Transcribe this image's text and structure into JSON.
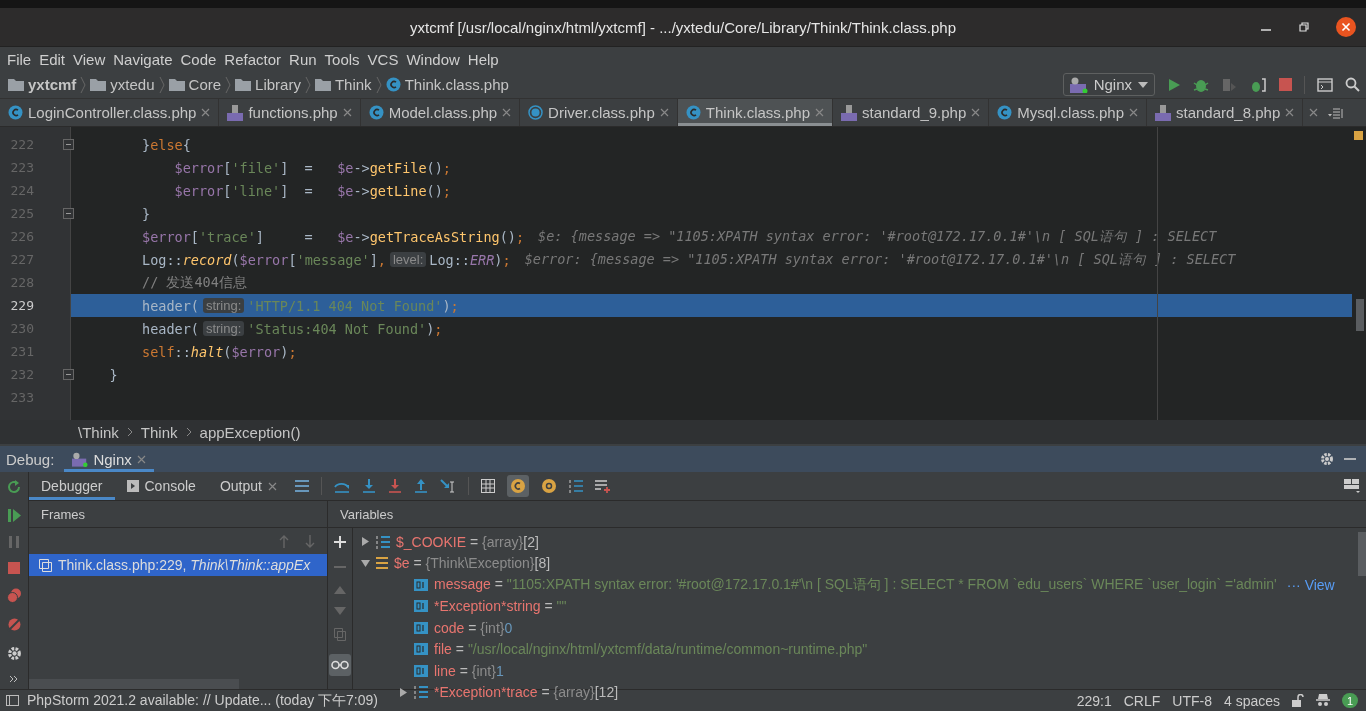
{
  "window": {
    "title": "yxtcmf [/usr/local/nginx/html/yxtcmf] - .../yxtedu/Core/Library/Think/Think.class.php"
  },
  "menu": [
    "File",
    "Edit",
    "View",
    "Navigate",
    "Code",
    "Refactor",
    "Run",
    "Tools",
    "VCS",
    "Window",
    "Help"
  ],
  "navbar": {
    "items": [
      {
        "label": "yxtcmf",
        "kind": "root"
      },
      {
        "label": "yxtedu",
        "kind": "folder"
      },
      {
        "label": "Core",
        "kind": "folder"
      },
      {
        "label": "Library",
        "kind": "folder"
      },
      {
        "label": "Think",
        "kind": "folder"
      },
      {
        "label": "Think.class.php",
        "kind": "class"
      }
    ],
    "run_config": "Nginx"
  },
  "tabs": [
    {
      "label": "LoginController.class.php",
      "kind": "class",
      "selected": false
    },
    {
      "label": "functions.php",
      "kind": "php",
      "selected": false
    },
    {
      "label": "Model.class.php",
      "kind": "class",
      "selected": false
    },
    {
      "label": "Driver.class.php",
      "kind": "abstract",
      "selected": false
    },
    {
      "label": "Think.class.php",
      "kind": "class",
      "selected": true
    },
    {
      "label": "standard_9.php",
      "kind": "php",
      "selected": false
    },
    {
      "label": "Mysql.class.php",
      "kind": "class",
      "selected": false
    },
    {
      "label": "standard_8.php",
      "kind": "php",
      "selected": false
    }
  ],
  "editor": {
    "lines": [
      {
        "number": "222",
        "fold": true,
        "selected": false,
        "tokens": [
          {
            "kind": "plain",
            "text": "        }"
          },
          {
            "kind": "keyword",
            "text": "else"
          },
          {
            "kind": "plain",
            "text": "{"
          }
        ]
      },
      {
        "number": "223",
        "fold": false,
        "selected": false,
        "tokens": [
          {
            "kind": "variable",
            "text": "            $error"
          },
          {
            "kind": "plain",
            "text": "["
          },
          {
            "kind": "string",
            "text": "'file'"
          },
          {
            "kind": "plain",
            "text": "]  =   "
          },
          {
            "kind": "variable",
            "text": "$e"
          },
          {
            "kind": "plain",
            "text": "->"
          },
          {
            "kind": "function",
            "text": "getFile"
          },
          {
            "kind": "plain",
            "text": "()"
          },
          {
            "kind": "keyword",
            "text": ";"
          }
        ]
      },
      {
        "number": "224",
        "fold": false,
        "selected": false,
        "tokens": [
          {
            "kind": "variable",
            "text": "            $error"
          },
          {
            "kind": "plain",
            "text": "["
          },
          {
            "kind": "string",
            "text": "'line'"
          },
          {
            "kind": "plain",
            "text": "]  =   "
          },
          {
            "kind": "variable",
            "text": "$e"
          },
          {
            "kind": "plain",
            "text": "->"
          },
          {
            "kind": "function",
            "text": "getLine"
          },
          {
            "kind": "plain",
            "text": "()"
          },
          {
            "kind": "keyword",
            "text": ";"
          }
        ]
      },
      {
        "number": "225",
        "fold": true,
        "selected": false,
        "tokens": [
          {
            "kind": "plain",
            "text": "        }"
          }
        ]
      },
      {
        "number": "226",
        "fold": false,
        "selected": false,
        "tokens": [
          {
            "kind": "variable",
            "text": "        $error"
          },
          {
            "kind": "plain",
            "text": "["
          },
          {
            "kind": "string",
            "text": "'trace'"
          },
          {
            "kind": "plain",
            "text": "]     =   "
          },
          {
            "kind": "variable",
            "text": "$e"
          },
          {
            "kind": "plain",
            "text": "->"
          },
          {
            "kind": "function",
            "text": "getTraceAsString"
          },
          {
            "kind": "plain",
            "text": "()"
          },
          {
            "kind": "keyword",
            "text": ";"
          },
          {
            "kind": "inline_value",
            "text": "$e: {message => \"1105:XPATH syntax error: '#root@172.17.0.1#'\\n [ SQL语句 ] : SELECT"
          }
        ]
      },
      {
        "number": "227",
        "fold": false,
        "selected": false,
        "tokens": [
          {
            "kind": "plain",
            "text": "        Log::"
          },
          {
            "kind": "method",
            "text": "record"
          },
          {
            "kind": "plain",
            "text": "("
          },
          {
            "kind": "variable",
            "text": "$error"
          },
          {
            "kind": "plain",
            "text": "["
          },
          {
            "kind": "string",
            "text": "'message'"
          },
          {
            "kind": "plain",
            "text": "]"
          },
          {
            "kind": "keyword",
            "text": ","
          },
          {
            "kind": "hint",
            "text": "level:"
          },
          {
            "kind": "plain",
            "text": "Log::"
          },
          {
            "kind": "constant",
            "text": "ERR"
          },
          {
            "kind": "plain",
            "text": ")"
          },
          {
            "kind": "keyword",
            "text": ";"
          },
          {
            "kind": "inline_value",
            "text": "$error: {message => \"1105:XPATH syntax error: '#root@172.17.0.1#'\\n [ SQL语句 ] : SELECT"
          }
        ]
      },
      {
        "number": "228",
        "fold": false,
        "selected": false,
        "tokens": [
          {
            "kind": "comment",
            "text": "        // 发送404信息"
          }
        ]
      },
      {
        "number": "229",
        "fold": false,
        "selected": true,
        "tokens": [
          {
            "kind": "plain",
            "text": "        header("
          },
          {
            "kind": "hint",
            "text": "string:"
          },
          {
            "kind": "string",
            "text": "'HTTP/1.1 404 Not Found'"
          },
          {
            "kind": "plain",
            "text": ")"
          },
          {
            "kind": "keyword",
            "text": ";"
          }
        ]
      },
      {
        "number": "230",
        "fold": false,
        "selected": false,
        "tokens": [
          {
            "kind": "plain",
            "text": "        header("
          },
          {
            "kind": "hint",
            "text": "string:"
          },
          {
            "kind": "string",
            "text": "'Status:404 Not Found'"
          },
          {
            "kind": "plain",
            "text": ")"
          },
          {
            "kind": "keyword",
            "text": ";"
          }
        ]
      },
      {
        "number": "231",
        "fold": false,
        "selected": false,
        "tokens": [
          {
            "kind": "keyword",
            "text": "        self"
          },
          {
            "kind": "plain",
            "text": "::"
          },
          {
            "kind": "method",
            "text": "halt"
          },
          {
            "kind": "plain",
            "text": "("
          },
          {
            "kind": "variable",
            "text": "$error"
          },
          {
            "kind": "plain",
            "text": ")"
          },
          {
            "kind": "keyword",
            "text": ";"
          }
        ]
      },
      {
        "number": "232",
        "fold": true,
        "selected": false,
        "tokens": [
          {
            "kind": "plain",
            "text": "    }"
          }
        ]
      },
      {
        "number": "233",
        "fold": false,
        "selected": false
      }
    ]
  },
  "breadcrumb": [
    "\\Think",
    "Think",
    "appException()"
  ],
  "debug": {
    "label": "Debug:",
    "session": "Nginx",
    "tabs": [
      {
        "label": "Debugger",
        "kind": "plain",
        "selected": true
      },
      {
        "label": "Console",
        "kind": "console",
        "selected": false
      },
      {
        "label": "Output",
        "kind": "closable",
        "selected": false
      }
    ],
    "frames_title": "Frames",
    "frames": [
      {
        "text": "Think.class.php:229, *Think\\Think::appEx*",
        "selected": true
      }
    ],
    "variables_title": "Variables",
    "variables": [
      {
        "name": "$_COOKIE",
        "sign": "=",
        "type": "{array}",
        "value": "[2]",
        "kind": "array",
        "expanded": false
      },
      {
        "name": "$e",
        "sign": "=",
        "type": "{Think\\Exception}",
        "value": "[8]",
        "kind": "object",
        "expanded": true,
        "children": [
          {
            "name": "message",
            "sign": "=",
            "value": "\"1105:XPATH syntax error: '#root@172.17.0.1#'\\n [ SQL语句 ] : SELECT * FROM `edu_users` WHERE `user_login` ='admin'",
            "kind": "string",
            "link": "··· View"
          },
          {
            "name": "*Exception*string",
            "sign": "=",
            "value": "\"\"",
            "kind": "string"
          },
          {
            "name": "code",
            "sign": "=",
            "type": "{int}",
            "value": "0",
            "kind": "int"
          },
          {
            "name": "file",
            "sign": "=",
            "value": "\"/usr/local/nginx/html/yxtcmf/data/runtime/common~runtime.php\"",
            "kind": "string"
          },
          {
            "name": "line",
            "sign": "=",
            "type": "{int}",
            "value": "1",
            "kind": "int"
          },
          {
            "name": "*Exception*trace",
            "sign": "=",
            "type": "{array}",
            "value": "[12]",
            "kind": "array",
            "expanded": false
          }
        ]
      }
    ]
  },
  "status_bar": {
    "message": "PhpStorm 2021.2 available: // Update... (today 下午7:09)",
    "position": "229:1",
    "line_separator": "CRLF",
    "encoding": "UTF-8",
    "indent": "4 spaces",
    "notifications": "1"
  }
}
